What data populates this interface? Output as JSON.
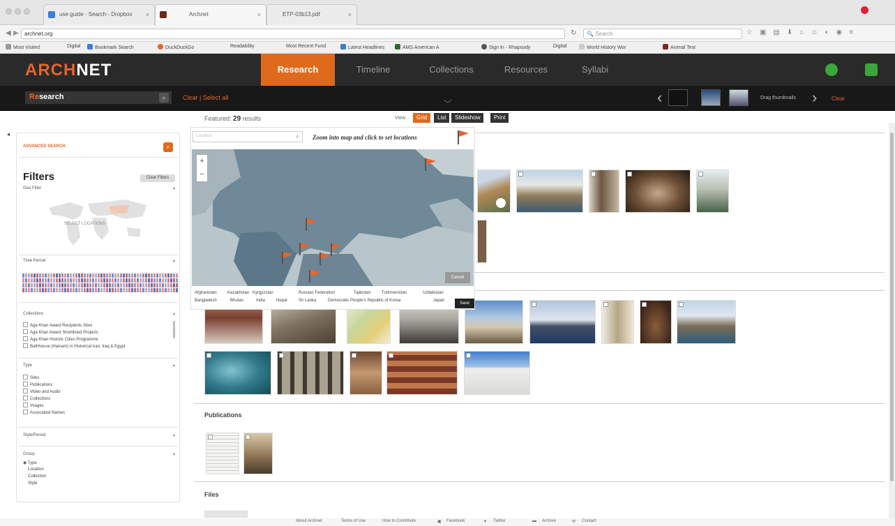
{
  "browser": {
    "tabs": [
      {
        "label": "use guide - Search - Dropbox"
      },
      {
        "label": "Archnet"
      },
      {
        "label": "ETP-03b13.pdf"
      }
    ],
    "url": "archnet.org",
    "search_placeholder": "Search",
    "bookmarks": [
      "Most Visited",
      "Digital",
      "Bookmark Search",
      "DuckDuckGo",
      "Readability",
      "Most Recent Fund",
      "Latest Headlines",
      "AMS American A",
      "Sign In - Rhapsody",
      "Digital",
      "World History Wor",
      "Animal Test"
    ]
  },
  "archnet": {
    "logo_accent": "ARCH",
    "logo_rest": "NET",
    "menu": [
      "Research",
      "Timeline",
      "Collections",
      "Resources",
      "Syllabi"
    ],
    "search_accent": "Re",
    "search_rest": "search",
    "clear_select": "Clear | Select all",
    "drag_thumbnails": "Drag thumbnails",
    "clear_right": "Clear"
  },
  "results": {
    "featured_label": "Featured:",
    "featured_count": "29",
    "featured_suffix": "results",
    "view_label": "View:",
    "views": [
      "Grid",
      "List",
      "Slideshow",
      "Print"
    ]
  },
  "sidebar": {
    "advanced_search": "ADVANCED SEARCH",
    "filters_title": "Filters",
    "clear_filters": "Clear Filters",
    "geo_filter": "Geo Filter",
    "select_locations": "SELECT LOCATIONS",
    "time_period": "Time Period",
    "collections_label": "Collections",
    "collections": [
      "Aga Khan Award Recipients Sites",
      "Aga Khan Award Shortlisted Projects",
      "Aga Khan Historic Cities Programme",
      "Bathhouse (Hamam) in Historical Iran, Iraq & Egypt"
    ],
    "type_label": "Type",
    "types": [
      "Sites",
      "Publications",
      "Video and Audio",
      "Collections",
      "Images",
      "Associated Names"
    ],
    "style_period": "Style/Period",
    "group_label": "Group",
    "groups": [
      "Type",
      "Location",
      "Collection",
      "Style"
    ]
  },
  "map": {
    "location_placeholder": "Location",
    "instruction": "Zoom into map and click to set locations",
    "cancel": "Cancel",
    "save": "Save",
    "countries": [
      "Afghanistan",
      "Kazakhstan",
      "Kyrgyzstan",
      "Russian Federation",
      "Tajikistan",
      "Turkmenistan",
      "Uzbekistan",
      "Bangladesh",
      "Bhutan",
      "India",
      "Nepal",
      "Sri Lanka",
      "Democratic People's Republic of Korea",
      "Japan"
    ]
  },
  "sections": {
    "publications": "Publications",
    "files": "Files"
  },
  "footer": [
    "About Archnet",
    "Terms of Use",
    "How to Contribute",
    "Facebook",
    "Twitter",
    "Archive",
    "Contact"
  ]
}
